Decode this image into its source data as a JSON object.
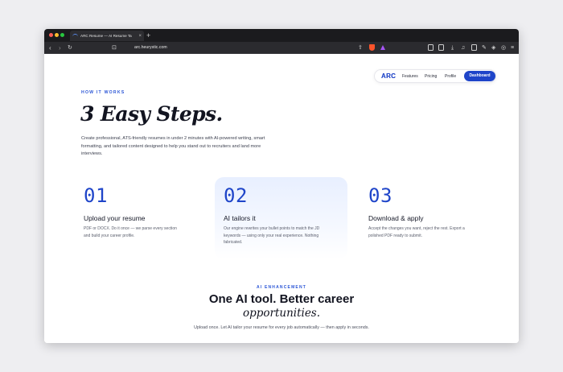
{
  "browser": {
    "tab_title": "ARC Resume — AI Resume Ta",
    "url": "arc.heurystic.com",
    "icons": [
      "back-icon",
      "forward-icon",
      "reload-icon",
      "bookmark-icon",
      "share-icon",
      "brave-shield-icon",
      "brave-rewards-icon",
      "download-icon",
      "media-icon",
      "sidebar-icon",
      "wallet-icon",
      "extensions-icon",
      "vpn-icon",
      "menu-icon"
    ]
  },
  "nav": {
    "logo": "ARC",
    "links": [
      "Features",
      "Pricing",
      "Profile"
    ],
    "cta": "Dashboard"
  },
  "hero": {
    "eyebrow": "HOW IT WORKS",
    "title": "3 Easy Steps.",
    "intro": "Create professional, ATS-friendly resumes in under 2 minutes with AI-powered writing, smart formatting, and tailored content designed to help you stand out to recruiters and land more interviews."
  },
  "steps": [
    {
      "num": "01",
      "title": "Upload your resume",
      "desc": "PDF or DOCX. Do it once — we parse every section and build your career profile."
    },
    {
      "num": "02",
      "title": "AI tailors it",
      "desc": "Our engine rewrites your bullet points to match the JD keywords — using only your real experience. Nothing fabricated."
    },
    {
      "num": "03",
      "title": "Download & apply",
      "desc": "Accept the changes you want, reject the rest. Export a polished PDF ready to submit."
    }
  ],
  "enhancement": {
    "eyebrow": "AI ENHANCEMENT",
    "title": "One AI tool. Better career",
    "title_italic": "opportunities.",
    "subtitle": "Upload once. Let AI tailor your resume for every job automatically — then apply in seconds."
  },
  "colors": {
    "accent": "#1f45c9",
    "eyebrow": "#2a55d6",
    "card_tint": "#e8efff"
  }
}
